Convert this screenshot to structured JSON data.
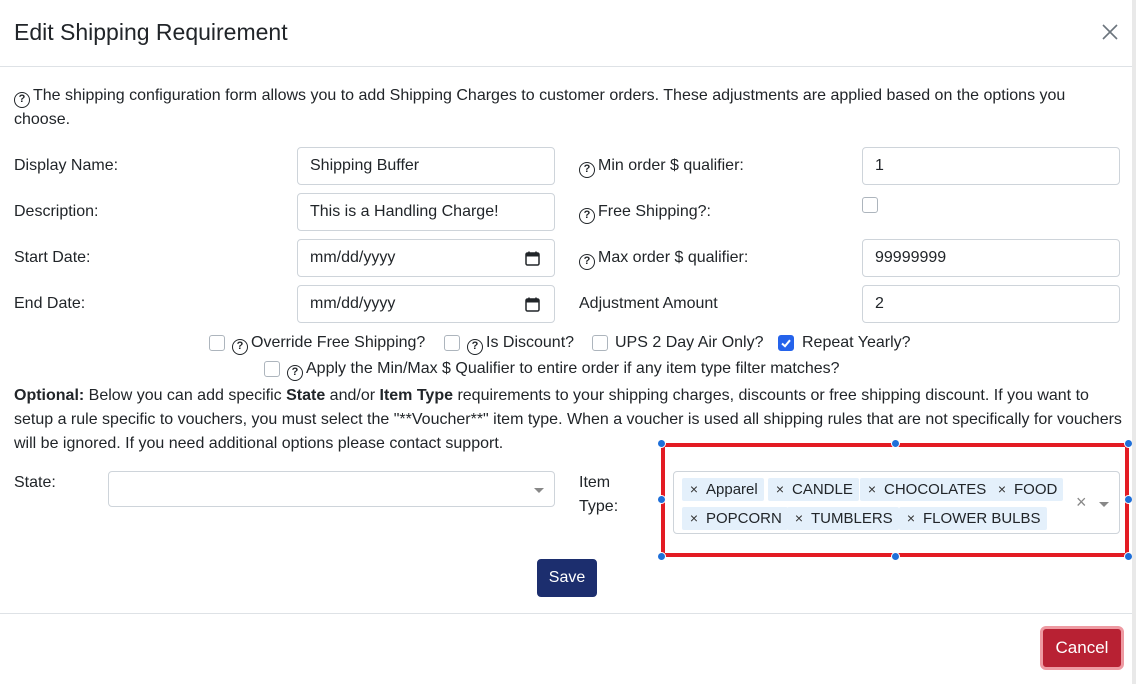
{
  "modal": {
    "title": "Edit Shipping Requirement",
    "intro": "The shipping configuration form allows you to add Shipping Charges to customer orders. These adjustments are applied based on the options you choose."
  },
  "form": {
    "display_name_label": "Display Name:",
    "display_name_value": "Shipping Buffer",
    "description_label": "Description:",
    "description_value": "This is a Handling Charge!",
    "start_date_label": "Start Date:",
    "start_date_placeholder": "mm/dd/yyyy",
    "end_date_label": "End Date:",
    "end_date_placeholder": "mm/dd/yyyy",
    "min_order_label": "Min order $ qualifier:",
    "min_order_value": "1",
    "free_shipping_label": "Free Shipping?:",
    "free_shipping_checked": false,
    "max_order_label": "Max order $ qualifier:",
    "max_order_value": "99999999",
    "adjustment_label": "Adjustment Amount",
    "adjustment_value": "2"
  },
  "options": {
    "override_free_shipping": {
      "label": "Override Free Shipping?",
      "checked": false
    },
    "is_discount": {
      "label": "Is Discount?",
      "checked": false
    },
    "ups_2day": {
      "label": "UPS 2 Day Air Only?",
      "checked": false
    },
    "repeat_yearly": {
      "label": "Repeat Yearly?",
      "checked": true
    },
    "apply_min_max": {
      "label": "Apply the Min/Max $ Qualifier to entire order if any item type filter matches?",
      "checked": false
    }
  },
  "optional": {
    "bold_prefix": "Optional:",
    "text_1": " Below you can add specific ",
    "bold_state": "State",
    "text_2": " and/or ",
    "bold_item_type": "Item Type",
    "text_3": " requirements to your shipping charges, discounts or free shipping discount. If you want to setup a rule specific to vouchers, you must select the \"**Voucher**\" item type. When a voucher is used all shipping rules that are not specifically for vouchers will be ignored. If you need additional options please contact support."
  },
  "state": {
    "label": "State:",
    "value": ""
  },
  "item_type": {
    "label_line1": "Item",
    "label_line2": "Type:",
    "tags": [
      "Apparel",
      "CANDLE",
      "CHOCOLATES",
      "FOOD",
      "POPCORN",
      "TUMBLERS",
      "FLOWER BULBS"
    ],
    "clear_symbol": "×"
  },
  "buttons": {
    "save": "Save",
    "cancel": "Cancel"
  },
  "colors": {
    "save_bg": "#1c2e6e",
    "cancel_bg": "#b82133",
    "highlight_border": "#e31b23",
    "checkbox_checked": "#2563eb",
    "tag_bg": "#e4f0fb"
  }
}
